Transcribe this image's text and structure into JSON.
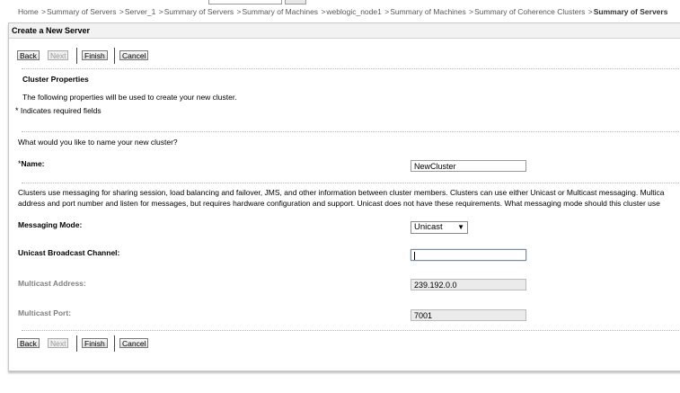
{
  "breadcrumb": {
    "items": [
      "Home",
      "Summary of Servers",
      "Server_1",
      "Summary of Servers",
      "Summary of Machines",
      "weblogic_node1",
      "Summary of Machines",
      "Summary of Coherence Clusters"
    ],
    "current": "Summary of Servers",
    "separator": ">"
  },
  "panel": {
    "title": "Create a New Server"
  },
  "buttons": {
    "back": "Back",
    "next": "Next",
    "finish": "Finish",
    "cancel": "Cancel"
  },
  "section": {
    "heading": "Cluster Properties",
    "intro": "The following properties will be used to create your new cluster.",
    "required_marker": "*",
    "required_note": "Indicates required fields"
  },
  "name_question": "What would you like to name your new cluster?",
  "name_field": {
    "label": "Name:",
    "value": "NewCluster"
  },
  "messaging_description": {
    "line1": "Clusters use messaging for sharing session, load balancing and failover, JMS, and other information between cluster members. Clusters can use either Unicast or Multicast messaging. Multica",
    "line2": "address and port number and listen for messages, but requires hardware configuration and support. Unicast does not have these requirements. What messaging mode should this cluster use"
  },
  "messaging_mode": {
    "label": "Messaging Mode:",
    "value": "Unicast"
  },
  "unicast_channel": {
    "label": "Unicast Broadcast Channel:",
    "value": ""
  },
  "multicast_address": {
    "label": "Multicast Address:",
    "value": "239.192.0.0"
  },
  "multicast_port": {
    "label": "Multicast Port:",
    "value": "7001"
  },
  "colors": {
    "panel_border": "#c8c8c8",
    "title_bg": "#f2f2f2",
    "readonly_bg": "#ebebeb",
    "disabled_text": "#808080"
  },
  "icons": {
    "dropdown": "chevron-down-icon"
  }
}
